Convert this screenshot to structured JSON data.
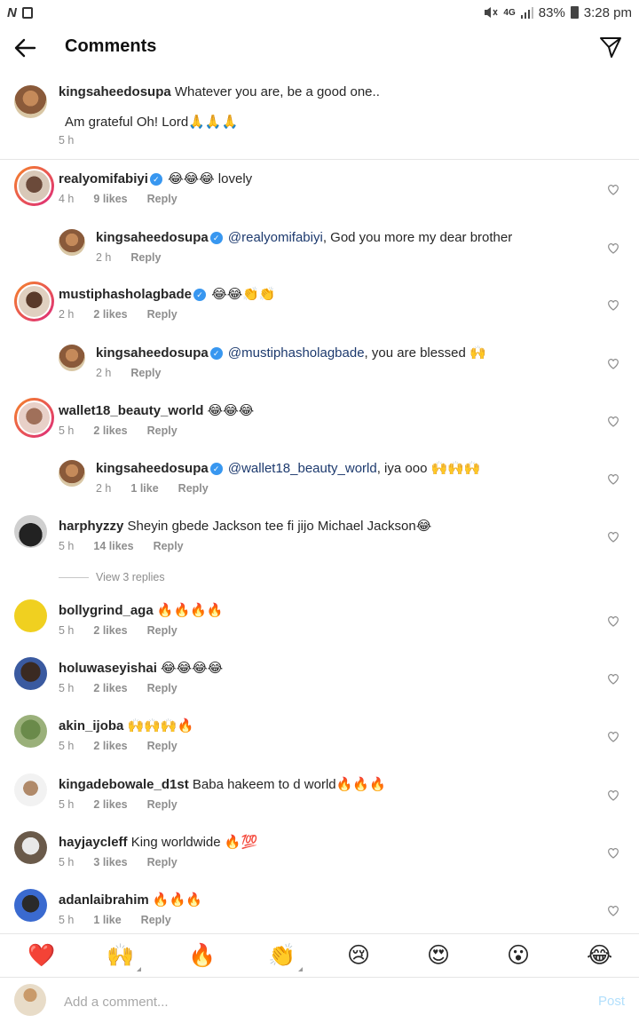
{
  "status_bar": {
    "left_logo": "N",
    "network": "4G",
    "battery": "83%",
    "time": "3:28 pm"
  },
  "header": {
    "title": "Comments",
    "back_icon": "arrow-left-icon",
    "send_icon": "paper-plane-icon"
  },
  "caption": {
    "username": "kingsaheedosupa",
    "text": "Whatever you are, be a good one..",
    "line2": "Am grateful Oh! Lord🙏🙏🙏",
    "time": "5 h"
  },
  "comments": [
    {
      "username": "realyomifabiyi",
      "verified": true,
      "text": "😂😂😂 lovely",
      "time": "4 h",
      "likes": "9 likes",
      "reply": "Reply"
    },
    {
      "username": "kingsaheedosupa",
      "verified": true,
      "mention": "@realyomifabiyi",
      "text": ", God you more my dear brother",
      "time": "2 h",
      "likes": "",
      "reply": "Reply"
    },
    {
      "username": "mustiphasholagbade",
      "verified": true,
      "text": "😂😂👏👏",
      "time": "2 h",
      "likes": "2 likes",
      "reply": "Reply"
    },
    {
      "username": "kingsaheedosupa",
      "verified": true,
      "mention": "@mustiphasholagbade",
      "text": ",  you are blessed 🙌",
      "time": "2 h",
      "likes": "",
      "reply": "Reply"
    },
    {
      "username": "wallet18_beauty_world",
      "verified": false,
      "text": "😂😂😂",
      "time": "5 h",
      "likes": "2 likes",
      "reply": "Reply"
    },
    {
      "username": "kingsaheedosupa",
      "verified": true,
      "mention": "@wallet18_beauty_world",
      "text": ", iya ooo 🙌🙌🙌",
      "time": "2 h",
      "likes": "1 like",
      "reply": "Reply"
    },
    {
      "username": "harphyzzy",
      "verified": false,
      "text": "Sheyin gbede Jackson tee fi jijo Michael Jackson😂",
      "time": "5 h",
      "likes": "14 likes",
      "reply": "Reply"
    },
    {
      "username": "bollygrind_aga",
      "verified": false,
      "text": "🔥🔥🔥🔥",
      "time": "5 h",
      "likes": "2 likes",
      "reply": "Reply"
    },
    {
      "username": "holuwaseyishai",
      "verified": false,
      "text": "😂😂😂😂",
      "time": "5 h",
      "likes": "2 likes",
      "reply": "Reply"
    },
    {
      "username": "akin_ijoba",
      "verified": false,
      "text": "🙌🙌🙌🔥",
      "time": "5 h",
      "likes": "2 likes",
      "reply": "Reply"
    },
    {
      "username": "kingadebowale_d1st",
      "verified": false,
      "text": "Baba hakeem to d world🔥🔥🔥",
      "time": "5 h",
      "likes": "2 likes",
      "reply": "Reply"
    },
    {
      "username": "hayjaycleff",
      "verified": false,
      "text": "King worldwide 🔥💯",
      "time": "5 h",
      "likes": "3 likes",
      "reply": "Reply"
    },
    {
      "username": "adanlaibrahim",
      "verified": false,
      "text": "🔥🔥🔥",
      "time": "5 h",
      "likes": "1 like",
      "reply": "Reply"
    }
  ],
  "view_replies": "View 3 replies",
  "emoji_bar": [
    "❤️",
    "🙌",
    "🔥",
    "👏",
    "😢",
    "😍",
    "😮",
    "😂"
  ],
  "composer": {
    "placeholder": "Add a comment...",
    "post_label": "Post"
  },
  "colors": {
    "verified": "#3897f0",
    "mention": "#1d3a6e",
    "post_disabled": "#b2dffc",
    "meta_grey": "#8e8e8e"
  }
}
